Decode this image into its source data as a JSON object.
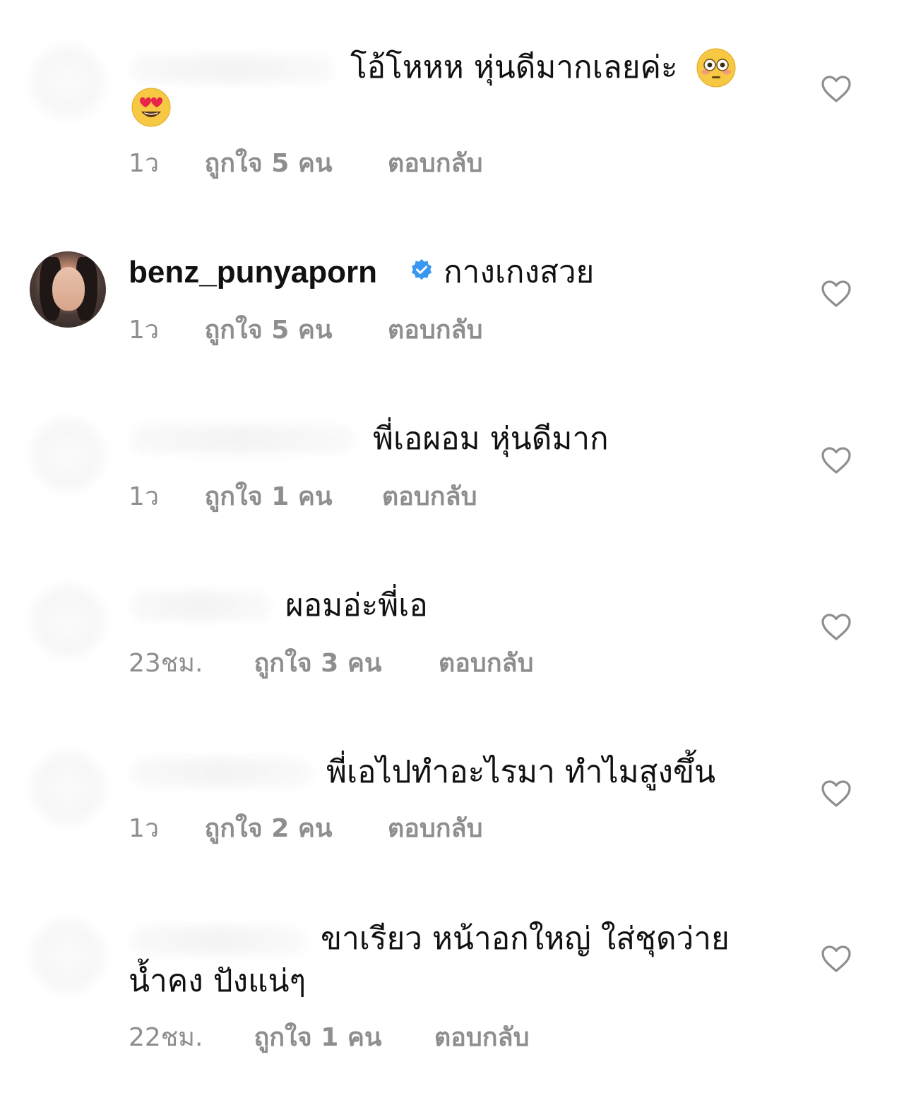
{
  "comments": [
    {
      "text": "โอ้โหหห หุ่นดีมากเลยค่ะ",
      "time": "1ว",
      "likes": "ถูกใจ 5 คน",
      "reply": "ตอบกลับ",
      "emojis": [
        "flushed-face-emoji",
        "heart-eyes-emoji"
      ]
    },
    {
      "username": "benz_punyaporn",
      "verified": true,
      "text": "กางเกงสวย",
      "time": "1ว",
      "likes": "ถูกใจ 5 คน",
      "reply": "ตอบกลับ"
    },
    {
      "text": "พี่เอผอม หุ่นดีมาก",
      "time": "1ว",
      "likes": "ถูกใจ 1 คน",
      "reply": "ตอบกลับ"
    },
    {
      "text": "ผอมอ่ะพี่เอ",
      "time": "23ชม.",
      "likes": "ถูกใจ 3 คน",
      "reply": "ตอบกลับ"
    },
    {
      "text": "พี่เอไปทำอะไรมา ทำไมสูงขึ้น",
      "time": "1ว",
      "likes": "ถูกใจ 2 คน",
      "reply": "ตอบกลับ"
    },
    {
      "text_line1": "ขาเรียว หน้าอกใหญ่ ใส่ชุดว่าย",
      "text_line2": "น้ำคง ปังแน่ๆ",
      "time": "22ชม.",
      "likes": "ถูกใจ 1 คน",
      "reply": "ตอบกลับ"
    }
  ],
  "colors": {
    "text": "#111111",
    "meta": "#8e8e8e",
    "verified_badge": "#3897f0",
    "heart_outline": "#8e8e8e"
  },
  "icons": {
    "like": "heart-outline-icon",
    "verified": "verified-badge-icon"
  }
}
